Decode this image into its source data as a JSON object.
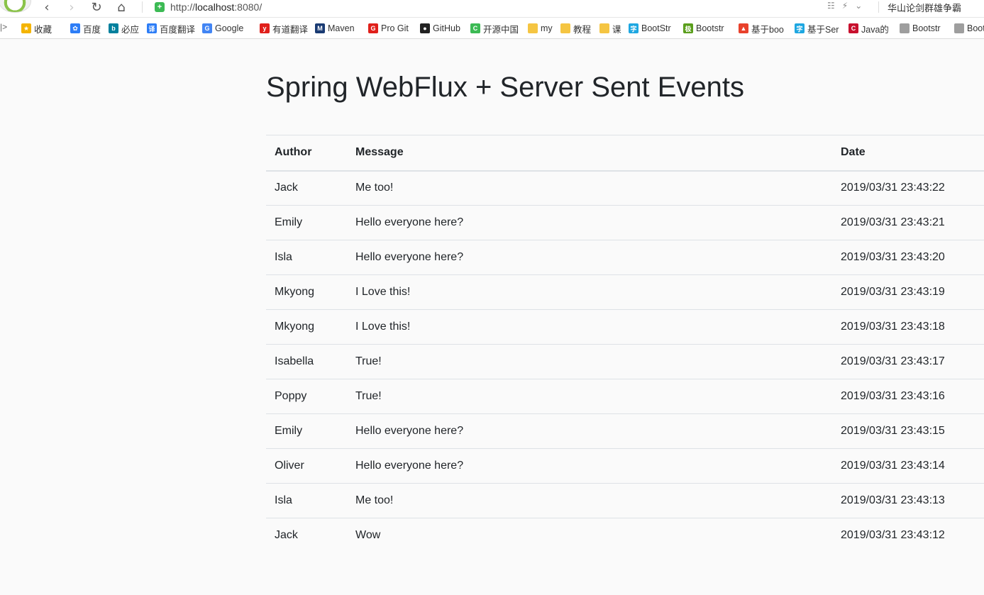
{
  "browser": {
    "url_prefix": "http://",
    "url_host": "localhost",
    "url_port_path": ":8080/",
    "profile_text": "华山论剑群雄争霸",
    "bookmarks": [
      {
        "label": "收藏",
        "color": "#f4b400",
        "glyph": "★"
      },
      {
        "label": "百度",
        "color": "#2d7df6",
        "glyph": "✿"
      },
      {
        "label": "必应",
        "color": "#00809d",
        "glyph": "b"
      },
      {
        "label": "百度翻译",
        "color": "#2d7df6",
        "glyph": "译"
      },
      {
        "label": "Google",
        "color": "#4285f4",
        "glyph": "G"
      },
      {
        "label": "有道翻译",
        "color": "#e0201b",
        "glyph": "y"
      },
      {
        "label": "Maven",
        "color": "#1a3b73",
        "glyph": "M"
      },
      {
        "label": "Pro Git",
        "color": "#e0201b",
        "glyph": "G"
      },
      {
        "label": "GitHub",
        "color": "#222222",
        "glyph": "●"
      },
      {
        "label": "开源中国",
        "color": "#3cba54",
        "glyph": "C"
      },
      {
        "label": "my",
        "color": "#f5c542",
        "glyph": ""
      },
      {
        "label": "教程",
        "color": "#f5c542",
        "glyph": ""
      },
      {
        "label": "课",
        "color": "#f5c542",
        "glyph": ""
      },
      {
        "label": "BootStr",
        "color": "#1ea7e1",
        "glyph": "字"
      },
      {
        "label": "Bootstr",
        "color": "#5a9e1c",
        "glyph": "极"
      },
      {
        "label": "基于boo",
        "color": "#e8412c",
        "glyph": "▲"
      },
      {
        "label": "基于Ser",
        "color": "#1ea7e1",
        "glyph": "字"
      },
      {
        "label": "Java的",
        "color": "#c8102e",
        "glyph": "C"
      },
      {
        "label": "Bootstr",
        "color": "#9e9e9e",
        "glyph": ""
      },
      {
        "label": "Boot",
        "color": "#9e9e9e",
        "glyph": ""
      }
    ]
  },
  "page": {
    "title": "Spring WebFlux + Server Sent Events",
    "table": {
      "headers": {
        "author": "Author",
        "message": "Message",
        "date": "Date"
      },
      "rows": [
        {
          "author": "Jack",
          "message": "Me too!",
          "date": "2019/03/31 23:43:22"
        },
        {
          "author": "Emily",
          "message": "Hello everyone here?",
          "date": "2019/03/31 23:43:21"
        },
        {
          "author": "Isla",
          "message": "Hello everyone here?",
          "date": "2019/03/31 23:43:20"
        },
        {
          "author": "Mkyong",
          "message": "I Love this!",
          "date": "2019/03/31 23:43:19"
        },
        {
          "author": "Mkyong",
          "message": "I Love this!",
          "date": "2019/03/31 23:43:18"
        },
        {
          "author": "Isabella",
          "message": "True!",
          "date": "2019/03/31 23:43:17"
        },
        {
          "author": "Poppy",
          "message": "True!",
          "date": "2019/03/31 23:43:16"
        },
        {
          "author": "Emily",
          "message": "Hello everyone here?",
          "date": "2019/03/31 23:43:15"
        },
        {
          "author": "Oliver",
          "message": "Hello everyone here?",
          "date": "2019/03/31 23:43:14"
        },
        {
          "author": "Isla",
          "message": "Me too!",
          "date": "2019/03/31 23:43:13"
        },
        {
          "author": "Jack",
          "message": "Wow",
          "date": "2019/03/31 23:43:12"
        }
      ]
    }
  }
}
